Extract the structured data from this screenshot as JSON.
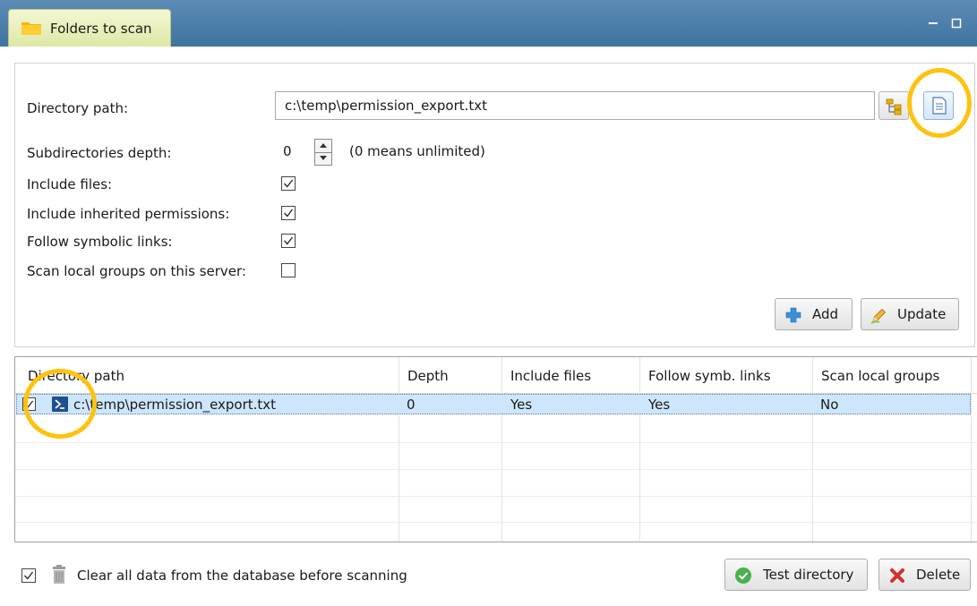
{
  "tab": {
    "label": "Folders to scan",
    "icon": "folder-icon"
  },
  "window_controls": {
    "minimize_icon": "minimize-icon",
    "restore_icon": "restore-icon"
  },
  "form": {
    "directory_path_label": "Directory path:",
    "directory_path_value": "c:\\temp\\permission_export.txt",
    "browse_folder_icon": "folder-tree-icon",
    "browse_file_icon": "text-file-icon",
    "subdirectories_depth_label": "Subdirectories depth:",
    "subdirectories_depth_value": "0",
    "depth_hint": "(0 means unlimited)",
    "include_files_label": "Include files:",
    "include_files_checked": true,
    "include_inherited_label": "Include inherited permissions:",
    "include_inherited_checked": true,
    "follow_symlinks_label": "Follow symbolic links:",
    "follow_symlinks_checked": true,
    "scan_local_groups_label": "Scan local groups on this server:",
    "scan_local_groups_checked": false,
    "add_button": "Add",
    "update_button": "Update"
  },
  "grid": {
    "columns": [
      "Directory path",
      "Depth",
      "Include files",
      "Follow symb. links",
      "Scan local groups"
    ],
    "rows": [
      {
        "checked": true,
        "icon": "powershell-icon",
        "path": "c:\\temp\\permission_export.txt",
        "depth": "0",
        "include_files": "Yes",
        "follow_symlinks": "Yes",
        "scan_local_groups": "No"
      }
    ]
  },
  "bottom": {
    "clear_checked": true,
    "clear_label": "Clear all data from the database before scanning",
    "trash_icon": "trash-icon",
    "test_button": "Test directory",
    "delete_button": "Delete"
  },
  "colors": {
    "header": "#4a7eab",
    "tab": "#e8efb8",
    "selection": "#cde6fb",
    "highlight_ring": "#ffc20e"
  }
}
